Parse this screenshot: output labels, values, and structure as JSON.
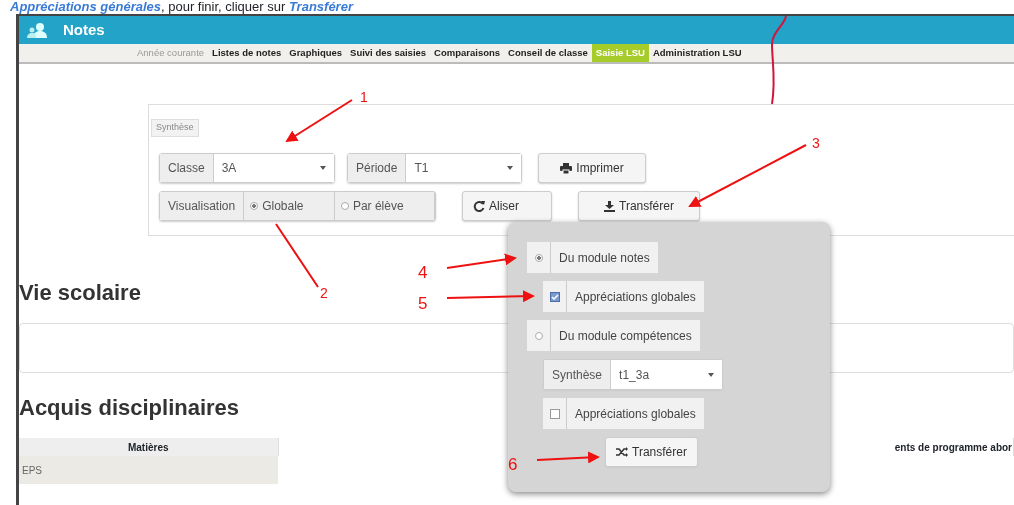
{
  "intro": "**Appréciations générales**, pour finir, cliquer sur **Transférer**",
  "app": {
    "title": "Notes"
  },
  "nav": [
    {
      "label": "Année courante",
      "disabled": true,
      "selected": false
    },
    {
      "label": "Listes de notes",
      "disabled": false,
      "selected": false
    },
    {
      "label": "Graphiques",
      "disabled": false,
      "selected": false
    },
    {
      "label": "Suivi des saisies",
      "disabled": false,
      "selected": false
    },
    {
      "label": "Comparaisons",
      "disabled": false,
      "selected": false
    },
    {
      "label": "Conseil de classe",
      "disabled": false,
      "selected": false
    },
    {
      "label": "Saisie LSU",
      "disabled": false,
      "selected": true
    },
    {
      "label": "Administration LSU",
      "disabled": false,
      "selected": false
    }
  ],
  "synthese": {
    "legend": "Synthèse",
    "classe": {
      "label": "Classe",
      "value": "3A"
    },
    "periode": {
      "label": "Période",
      "value": "T1"
    },
    "print_button": "Imprimer",
    "visualisation": {
      "label": "Visualisation",
      "options": [
        {
          "label": "Globale",
          "selected": true
        },
        {
          "label": "Par élève",
          "selected": false
        }
      ]
    },
    "refresh_button": "Aliser",
    "transfer_button": "Transférer"
  },
  "sections": [
    "Vie scolaire",
    "Acquis disciplinaires"
  ],
  "table": {
    "columns": [
      "Matières",
      "ents de programme abor"
    ],
    "rows": [
      [
        "EPS"
      ]
    ]
  },
  "popup": {
    "items": [
      {
        "kind": "radio",
        "label": "Du module notes",
        "selected": true
      },
      {
        "kind": "checkbox",
        "label": "Appréciations globales",
        "checked": true
      },
      {
        "kind": "radio",
        "label": "Du module compétences",
        "selected": false
      },
      {
        "kind": "select",
        "label": "Synthèse",
        "value": "t1_3a"
      },
      {
        "kind": "checkbox",
        "label": "Appréciations globales",
        "checked": false
      }
    ],
    "button": "Transférer"
  },
  "annotations": [
    {
      "label": "1"
    },
    {
      "label": "2"
    },
    {
      "label": "3"
    },
    {
      "label": "4"
    },
    {
      "label": "5"
    },
    {
      "label": "6"
    }
  ]
}
